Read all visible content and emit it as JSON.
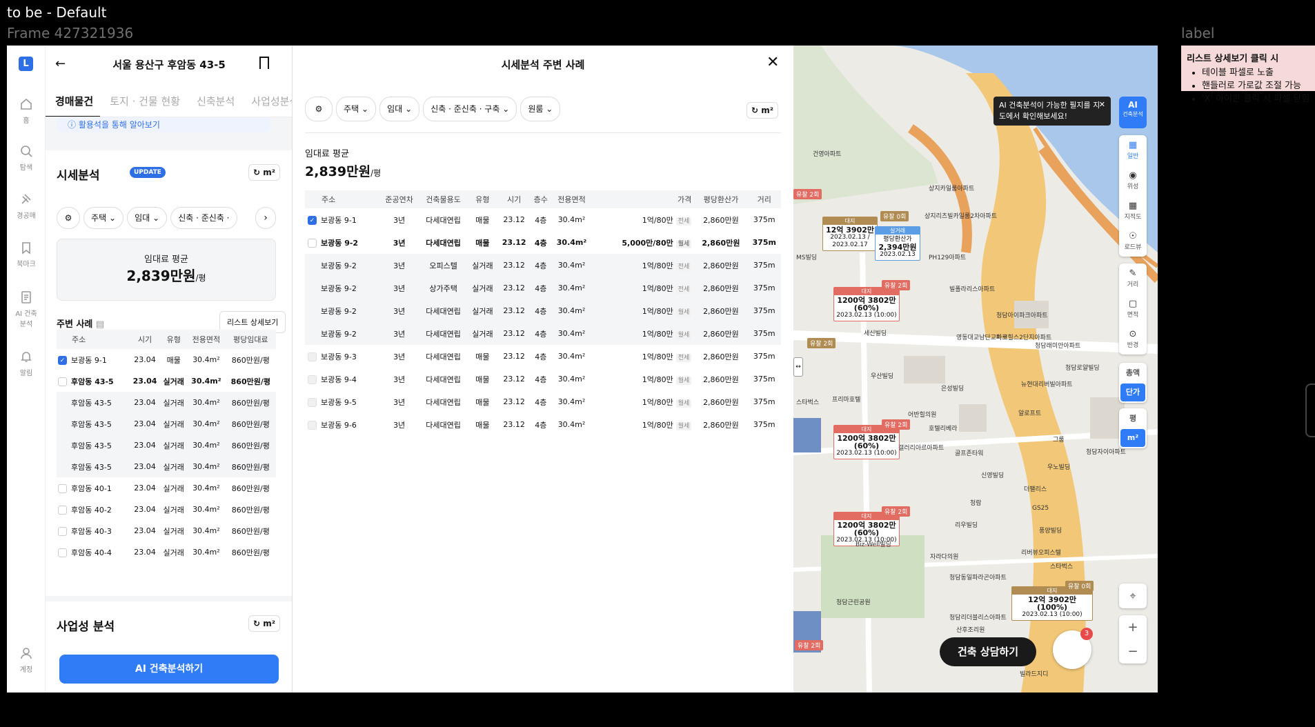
{
  "canvas": {
    "title": "to be - Default",
    "frame_name": "Frame 427321936",
    "label_heading": "label",
    "note": {
      "title": "리스트 상세보기 클릭 시",
      "items": [
        "테이블 파셀로 노출",
        "핸들러로 가로값 조절 가능",
        "'X' 아이콘 클릭 시 파셀 닫힘"
      ]
    }
  },
  "nav": {
    "logo": "L",
    "items": [
      {
        "label": "홈",
        "icon": "home-icon"
      },
      {
        "label": "탐색",
        "icon": "search-icon"
      },
      {
        "label": "경공매",
        "icon": "gavel-icon"
      },
      {
        "label": "북마크",
        "icon": "bookmark-icon"
      },
      {
        "label": "AI 건축분석",
        "icon": "ai-document-icon"
      },
      {
        "label": "알림",
        "icon": "bell-icon"
      },
      {
        "label": "계정",
        "icon": "user-icon"
      }
    ]
  },
  "left_panel": {
    "title": "서울 용산구 후암동 43-5",
    "tabs": [
      "경매물건",
      "토지 · 건물 현황",
      "신축분석",
      "사업성분석"
    ],
    "strip_text": "활용석을 통해 알아보기",
    "market": {
      "title": "시세분석",
      "badge": "UPDATE",
      "unit_label": "m²",
      "filters": [
        "주택",
        "임대",
        "신축 · 준신축 ·"
      ],
      "avg_label": "임대료 평균",
      "avg_value": "2,839만원",
      "avg_unit": "/평"
    },
    "nearby": {
      "title": "주변 사례",
      "list_button": "리스트 상세보기",
      "columns": [
        "주소",
        "시기",
        "유형",
        "전용면적",
        "평당임대료"
      ],
      "rows": [
        {
          "addr": "보광동 9-1",
          "period": "23.04",
          "type": "매물",
          "area": "30.4m²",
          "rent": "860만원/평",
          "state": "checked"
        },
        {
          "addr": "후암동 43-5",
          "period": "23.04",
          "type": "실거래",
          "area": "30.4m²",
          "rent": "860만원/평",
          "state": "group"
        },
        {
          "addr": "후암동 43-5",
          "period": "23.04",
          "type": "실거래",
          "area": "30.4m²",
          "rent": "860만원/평",
          "state": "child"
        },
        {
          "addr": "후암동 43-5",
          "period": "23.04",
          "type": "실거래",
          "area": "30.4m²",
          "rent": "860만원/평",
          "state": "child"
        },
        {
          "addr": "후암동 43-5",
          "period": "23.04",
          "type": "실거래",
          "area": "30.4m²",
          "rent": "860만원/평",
          "state": "child"
        },
        {
          "addr": "후암동 43-5",
          "period": "23.04",
          "type": "실거래",
          "area": "30.4m²",
          "rent": "860만원/평",
          "state": "child"
        },
        {
          "addr": "후암동 40-1",
          "period": "23.04",
          "type": "실거래",
          "area": "30.4m²",
          "rent": "860만원/평",
          "state": "unchecked"
        },
        {
          "addr": "후암동 40-2",
          "period": "23.04",
          "type": "실거래",
          "area": "30.4m²",
          "rent": "860만원/평",
          "state": "unchecked"
        },
        {
          "addr": "후암동 40-3",
          "period": "23.04",
          "type": "실거래",
          "area": "30.4m²",
          "rent": "860만원/평",
          "state": "unchecked"
        },
        {
          "addr": "후암동 40-4",
          "period": "23.04",
          "type": "실거래",
          "area": "30.4m²",
          "rent": "860만원/평",
          "state": "unchecked"
        }
      ]
    },
    "business": {
      "title": "사업성 분석",
      "unit_label": "m²"
    },
    "cta": "AI 건축분석하기"
  },
  "modal": {
    "title": "시세분석 주변 사례",
    "filters": [
      "주택",
      "임대",
      "신축 · 준신축 · 구축",
      "원룸"
    ],
    "unit_label": "m²",
    "avg_label": "임대료 평균",
    "avg_value": "2,839만원",
    "avg_unit": "/평",
    "columns": [
      "주소",
      "준공연차",
      "건축물용도",
      "유형",
      "시기",
      "층수",
      "전용면적",
      "가격",
      "평당환산가",
      "거리"
    ],
    "rows": [
      {
        "addr": "보광동 9-1",
        "age": "3년",
        "use": "다세대연립",
        "type": "매물",
        "period": "23.12",
        "floor": "4층",
        "area": "30.4m²",
        "price": "1억/80만",
        "tag": "전세",
        "per": "2,860만원",
        "dist": "375m",
        "state": "checked"
      },
      {
        "addr": "보광동 9-2",
        "age": "3년",
        "use": "다세대연립",
        "type": "매물",
        "period": "23.12",
        "floor": "4층",
        "area": "30.4m²",
        "price": "5,000만/80만",
        "tag": "월세",
        "per": "2,860만원",
        "dist": "375m",
        "state": "group"
      },
      {
        "addr": "보광동 9-2",
        "age": "3년",
        "use": "오피스텔",
        "type": "실거래",
        "period": "23.12",
        "floor": "4층",
        "area": "30.4m²",
        "price": "1억/80만",
        "tag": "전세",
        "per": "2,860만원",
        "dist": "375m",
        "state": "child"
      },
      {
        "addr": "보광동 9-2",
        "age": "3년",
        "use": "상가주택",
        "type": "실거래",
        "period": "23.12",
        "floor": "4층",
        "area": "30.4m²",
        "price": "1억/80만",
        "tag": "전세",
        "per": "2,860만원",
        "dist": "375m",
        "state": "child"
      },
      {
        "addr": "보광동 9-2",
        "age": "3년",
        "use": "다세대연립",
        "type": "실거래",
        "period": "23.12",
        "floor": "4층",
        "area": "30.4m²",
        "price": "1억/80만",
        "tag": "월세",
        "per": "2,860만원",
        "dist": "375m",
        "state": "child"
      },
      {
        "addr": "보광동 9-2",
        "age": "3년",
        "use": "다세대연립",
        "type": "실거래",
        "period": "23.12",
        "floor": "4층",
        "area": "30.4m²",
        "price": "1억/80만",
        "tag": "월세",
        "per": "2,860만원",
        "dist": "375m",
        "state": "child"
      },
      {
        "addr": "보광동 9-3",
        "age": "3년",
        "use": "다세대연립",
        "type": "매물",
        "period": "23.12",
        "floor": "4층",
        "area": "30.4m²",
        "price": "1억/80만",
        "tag": "전세",
        "per": "2,860만원",
        "dist": "375m",
        "state": "unchecked"
      },
      {
        "addr": "보광동 9-4",
        "age": "3년",
        "use": "다세대연립",
        "type": "매물",
        "period": "23.12",
        "floor": "4층",
        "area": "30.4m²",
        "price": "1억/80만",
        "tag": "월세",
        "per": "2,860만원",
        "dist": "375m",
        "state": "unchecked"
      },
      {
        "addr": "보광동 9-5",
        "age": "3년",
        "use": "다세대연립",
        "type": "매물",
        "period": "23.12",
        "floor": "4층",
        "area": "30.4m²",
        "price": "1억/80만",
        "tag": "월세",
        "per": "2,860만원",
        "dist": "375m",
        "state": "unchecked"
      },
      {
        "addr": "보광동 9-6",
        "age": "3년",
        "use": "다세대연립",
        "type": "매물",
        "period": "23.12",
        "floor": "4층",
        "area": "30.4m²",
        "price": "1억/80만",
        "tag": "월세",
        "per": "2,860만원",
        "dist": "375m",
        "state": "unchecked"
      }
    ]
  },
  "map": {
    "tooltip": "AI 건축분석이 가능한 필지를 지도에서 확인해보세요!",
    "ai_button": "AI",
    "ai_button_sub": "건축분석",
    "layers": [
      "일반",
      "위성",
      "지적도",
      "로드뷰"
    ],
    "measure": [
      "거리",
      "면적",
      "반경"
    ],
    "price_mode": [
      "총액",
      "단가"
    ],
    "unit_mode": [
      "평",
      "m²"
    ],
    "consult": "건축 상담하기",
    "bot_badge": "3",
    "pins": [
      {
        "tag": "대지",
        "main": "12억 3902만",
        "sub": "2023.02.13 / 2023.02.17"
      },
      {
        "tag": "실거래",
        "main": "2,394만원",
        "sub": "2023.02.13",
        "label": "평당환산가"
      },
      {
        "tag": "대지",
        "main": "1200억 3802만 (60%)",
        "sub": "2023.02.13 (10:00)"
      },
      {
        "tag": "대지",
        "main": "1200억 3802만 (60%)",
        "sub": "2023.02.13 (10:00)"
      },
      {
        "tag": "대지",
        "main": "1200억 3802만 (60%)",
        "sub": "2023.02.13 (10:00)"
      },
      {
        "tag": "대지",
        "main": "12억 3902만 (100%)",
        "sub": "2023.02.13 (10:00)"
      }
    ],
    "flags": [
      "유찰 0회",
      "유찰 2회",
      "유찰 2회",
      "유찰 2회",
      "유찰 2회",
      "유찰 2회",
      "유찰 0회",
      "유찰 2회"
    ],
    "places": [
      "건영아파트",
      "상지카일룸아파트",
      "상지리츠빌카일룸2차아파트",
      "MS빌딩",
      "PH129아파트",
      "빌폴라리스아파트",
      "세신빌딩",
      "영동대교남단교차로",
      "청담아이파크아파트",
      "마크힐스2단지아파트",
      "청담래미안아파트",
      "청담로얄빌딩",
      "우산빌딩",
      "은성빌딩",
      "스타벅스",
      "프리마호텔",
      "어반힐의원",
      "호텔리베라",
      "뉴현대리버빌아파트",
      "알로프트",
      "갤러리아르아파트",
      "골프존타워",
      "신영빌딩",
      "청람",
      "그룸",
      "청담자이아파트",
      "우노빌딩",
      "더팰리스",
      "GS25",
      "리우빌딩",
      "풍양빌딩",
      "리버뷰오피스텔",
      "스타벅스",
      "자라다의원",
      "청담동일파라곤아파트",
      "청담근린공원",
      "청담리더블리스아파트",
      "산후조리원",
      "빌라드지디",
      "Biz-Well빌딩"
    ]
  }
}
